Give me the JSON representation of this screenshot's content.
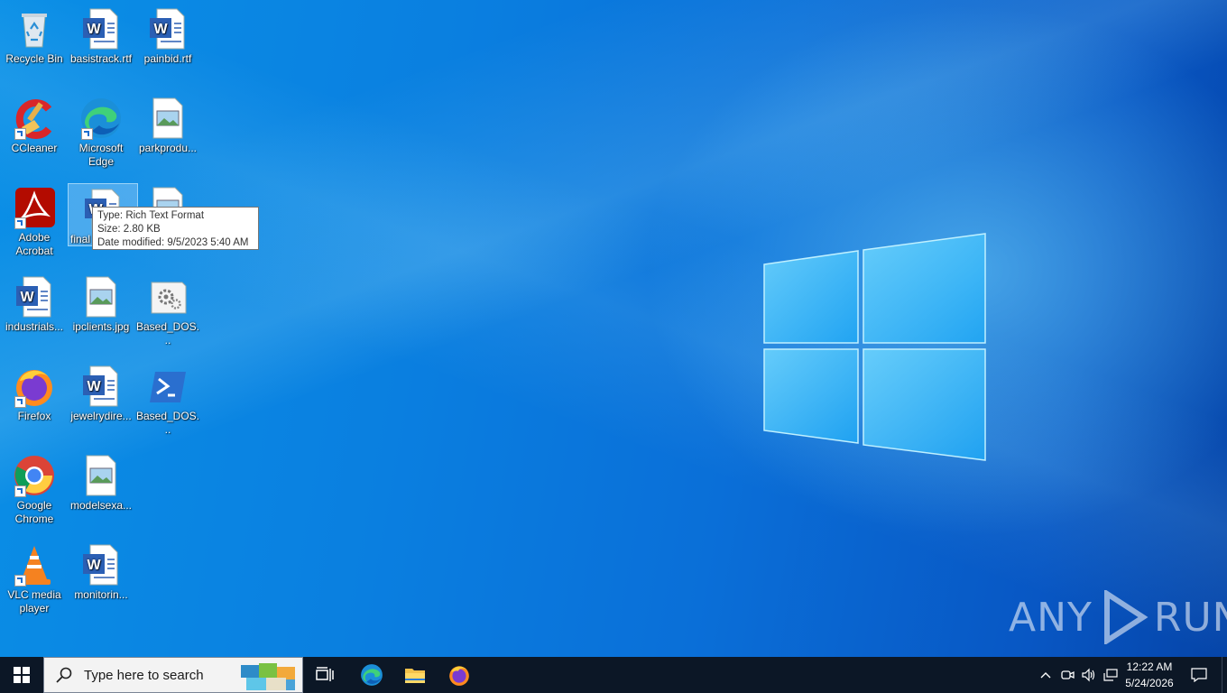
{
  "desktop": {
    "icons": [
      {
        "label": "Recycle Bin",
        "icon": "recycle-bin-icon"
      },
      {
        "label": "basistrack.rtf",
        "icon": "word-document-icon"
      },
      {
        "label": "painbid.rtf",
        "icon": "word-document-icon"
      },
      {
        "label": "CCleaner",
        "icon": "ccleaner-icon"
      },
      {
        "label": "Microsoft Edge",
        "icon": "edge-icon"
      },
      {
        "label": "parkprodu...",
        "icon": "image-file-icon"
      },
      {
        "label": "Adobe Acrobat",
        "icon": "adobe-acrobat-icon"
      },
      {
        "label": "final",
        "icon": "word-document-icon"
      },
      {
        "label": "industrials...",
        "icon": "word-document-icon"
      },
      {
        "label": "ipclients.jpg",
        "icon": "image-file-icon"
      },
      {
        "label": "Based_DOS...",
        "icon": "settings-file-icon"
      },
      {
        "label": "Firefox",
        "icon": "firefox-icon"
      },
      {
        "label": "jewelrydire...",
        "icon": "word-document-icon"
      },
      {
        "label": "Based_DOS...",
        "icon": "powershell-icon"
      },
      {
        "label": "Google Chrome",
        "icon": "chrome-icon"
      },
      {
        "label": "modelsexa...",
        "icon": "image-file-icon"
      },
      {
        "label": "VLC media player",
        "icon": "vlc-icon"
      },
      {
        "label": "monitorin...",
        "icon": "word-document-icon"
      }
    ],
    "tooltip": {
      "type": "Type: Rich Text Format",
      "size": "Size: 2.80 KB",
      "modified": "Date modified: 9/5/2023 5:40 AM"
    },
    "watermark": {
      "left": "ANY",
      "right": "RUN"
    }
  },
  "taskbar": {
    "search_placeholder": "Type here to search",
    "pinned": [
      "task-view-icon",
      "edge-icon",
      "file-explorer-icon",
      "firefox-icon"
    ],
    "tray_icons": [
      "chevron-up-icon",
      "meet-now-icon",
      "volume-icon",
      "network-icon"
    ],
    "clock": {
      "time": "12:22 AM",
      "date": "5/24/2026"
    }
  },
  "colors": {
    "taskbar": "#0c1726",
    "desktop_accent": "#0a7fe0"
  }
}
